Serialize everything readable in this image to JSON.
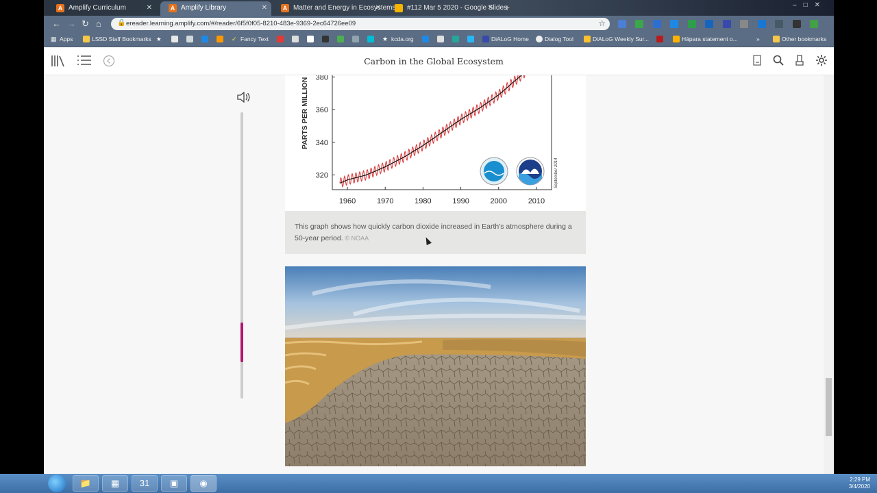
{
  "tabs": [
    {
      "label": "Amplify Curriculum",
      "active": false,
      "favicon": "A"
    },
    {
      "label": "Amplify Library",
      "active": true,
      "favicon": "A"
    },
    {
      "label": "Matter and Energy in Ecosystems",
      "active": false,
      "favicon": "A"
    },
    {
      "label": "#112 Mar 5 2020 - Google Slides",
      "active": false,
      "favicon": "slides-icon"
    }
  ],
  "address": {
    "url": "ereader.learning.amplify.com/#/reader/6f5f0f05-8210-483e-9369-2ec64726ee09"
  },
  "bookmarks": [
    "Apps",
    "LSSD Staff Bookmarks",
    "Fancy Text",
    "kcda.org",
    "DiALoG Home",
    "Dialog Tool",
    "DiALoG Weekly Sur...",
    "Hāpara statement o...",
    "Other bookmarks"
  ],
  "reader": {
    "title": "Carbon in the Global Ecosystem",
    "reading_progress": 0.13
  },
  "chart_data": {
    "type": "line",
    "ylabel": "PARTS PER MILLION",
    "x_ticks": [
      1960,
      1970,
      1980,
      1990,
      2000,
      2010
    ],
    "y_ticks": [
      320,
      340,
      360,
      380
    ],
    "xlim": [
      1956,
      2014
    ],
    "ylim": [
      311,
      381
    ],
    "series": [
      {
        "x": [
          1958,
          1960,
          1965,
          1970,
          1975,
          1980,
          1985,
          1990,
          1995,
          2000,
          2005,
          2007
        ],
        "values": [
          315,
          317,
          320,
          325,
          331,
          338,
          346,
          354,
          361,
          369,
          379,
          383
        ]
      }
    ],
    "side_note": "September 2014",
    "line_colors": {
      "seasonal": "#d94040",
      "trend": "#111111"
    }
  },
  "caption": {
    "text": "This graph shows how quickly carbon dioxide increased in Earth's atmosphere during a 50-year period.",
    "credit": "© NOAA"
  },
  "taskbar": {
    "time": "2:29 PM",
    "date": "3/4/2020",
    "calendar_day": "31"
  },
  "colors": {
    "accent": "#b0186c",
    "chrome": "#5b6d84"
  }
}
